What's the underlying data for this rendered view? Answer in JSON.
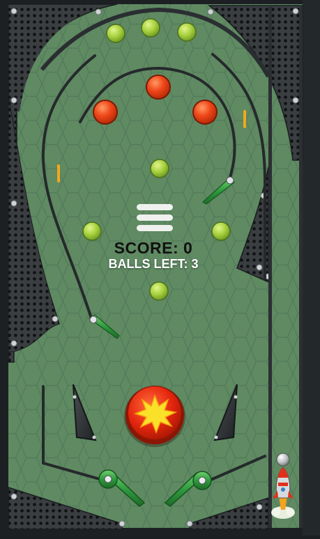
{
  "hud": {
    "score_label": "SCORE: 0",
    "balls_left_label": "BALLS LEFT: 3"
  },
  "colors": {
    "playfield": "#5f8a62",
    "bumper_green": "#a4cf3e",
    "bumper_red": "#ee3d12",
    "flipper": "#3aa04a",
    "rail": "#25292b",
    "frame_dark": "#2a2d30",
    "lane_marker": "#f2a81c"
  },
  "icons": {
    "menu": "hamburger-menu-icon",
    "center_bumper": "starburst-icon",
    "launcher": "rocket-icon"
  }
}
